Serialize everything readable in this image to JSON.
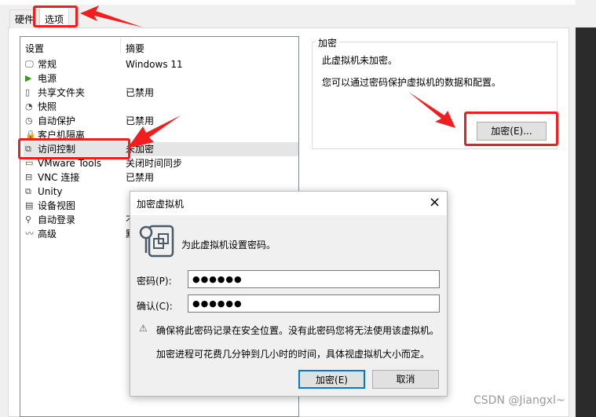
{
  "tabs": [
    {
      "label": "硬件"
    },
    {
      "label": "选项"
    }
  ],
  "list": {
    "col_setting": "设置",
    "col_summary": "摘要",
    "items": [
      {
        "name": "常规",
        "summary": "Windows 11",
        "icon": "monitor-icon"
      },
      {
        "name": "电源",
        "summary": "",
        "icon": "play-icon"
      },
      {
        "name": "共享文件夹",
        "summary": "已禁用",
        "icon": "folder-share-icon"
      },
      {
        "name": "快照",
        "summary": "",
        "icon": "snapshot-icon"
      },
      {
        "name": "自动保护",
        "summary": "已禁用",
        "icon": "clock-icon"
      },
      {
        "name": "客户机隔离",
        "summary": "",
        "icon": "lock-icon"
      },
      {
        "name": "访问控制",
        "summary": "未加密",
        "icon": "access-lock-icon"
      },
      {
        "name": "VMware Tools",
        "summary": "关闭时间同步",
        "icon": "vm-icon"
      },
      {
        "name": "VNC 连接",
        "summary": "已禁用",
        "icon": "vnc-icon"
      },
      {
        "name": "Unity",
        "summary": "",
        "icon": "unity-icon"
      },
      {
        "name": "设备视图",
        "summary": "",
        "icon": "device-view-icon"
      },
      {
        "name": "自动登录",
        "summary": "不",
        "icon": "user-key-icon"
      },
      {
        "name": "高级",
        "summary": "默",
        "icon": "advanced-icon"
      }
    ]
  },
  "encryption": {
    "group_label": "加密",
    "status": "此虚拟机未加密。",
    "desc": "您可以通过密码保护虚拟机的数据和配置。",
    "button": "加密(E)..."
  },
  "dialog": {
    "title": "加密虚拟机",
    "close": "×",
    "prompt": "为此虚拟机设置密码。",
    "password_label": "密码(P):",
    "password_value": "●●●●●●",
    "confirm_label": "确认(C):",
    "confirm_value": "●●●●●●",
    "warning": "确保将此密码记录在安全位置。没有此密码您将无法使用该虚拟机。",
    "note": "加密进程可花费几分钟到几小时的时间，具体视虚拟机大小而定。",
    "ok": "加密(E)",
    "cancel": "取消"
  },
  "watermark": "CSDN @Jiangxl~",
  "colors": {
    "annotation": "#f21d1d",
    "focus": "#0078d7"
  }
}
